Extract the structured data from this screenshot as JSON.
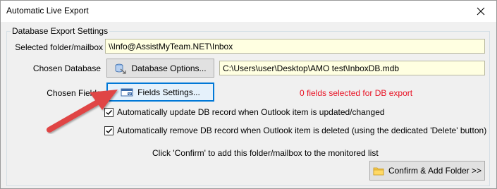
{
  "window": {
    "title": "Automatic Live Export"
  },
  "group": {
    "label": "Database Export Settings"
  },
  "rows": {
    "folder": {
      "label": "Selected folder/mailbox",
      "value": "\\\\Info@AssistMyTeam.NET\\Inbox"
    },
    "database": {
      "label": "Chosen Database",
      "button": "Database Options...",
      "value": "C:\\Users\\user\\Desktop\\AMO test\\InboxDB.mdb"
    },
    "fields": {
      "label": "Chosen Fields",
      "button": "Fields Settings...",
      "status": "0 fields selected for DB export"
    }
  },
  "options": {
    "update": {
      "label": "Automatically update DB record when Outlook item is updated/changed",
      "checked": true
    },
    "remove": {
      "label": "Automatically remove DB record when Outlook item is deleted (using the dedicated 'Delete' button)",
      "checked": true
    }
  },
  "info": "Click 'Confirm' to add this folder/mailbox to the monitored list",
  "confirm_button": "Confirm & Add Folder >>",
  "colors": {
    "field_bg": "#ffffe1",
    "status_red": "#e81123",
    "arrow": "#e04545",
    "focus": "#0078d7"
  },
  "icons": {
    "close": "close-icon",
    "database": "database-icon",
    "fields": "fields-settings-icon",
    "folder": "folder-icon"
  }
}
